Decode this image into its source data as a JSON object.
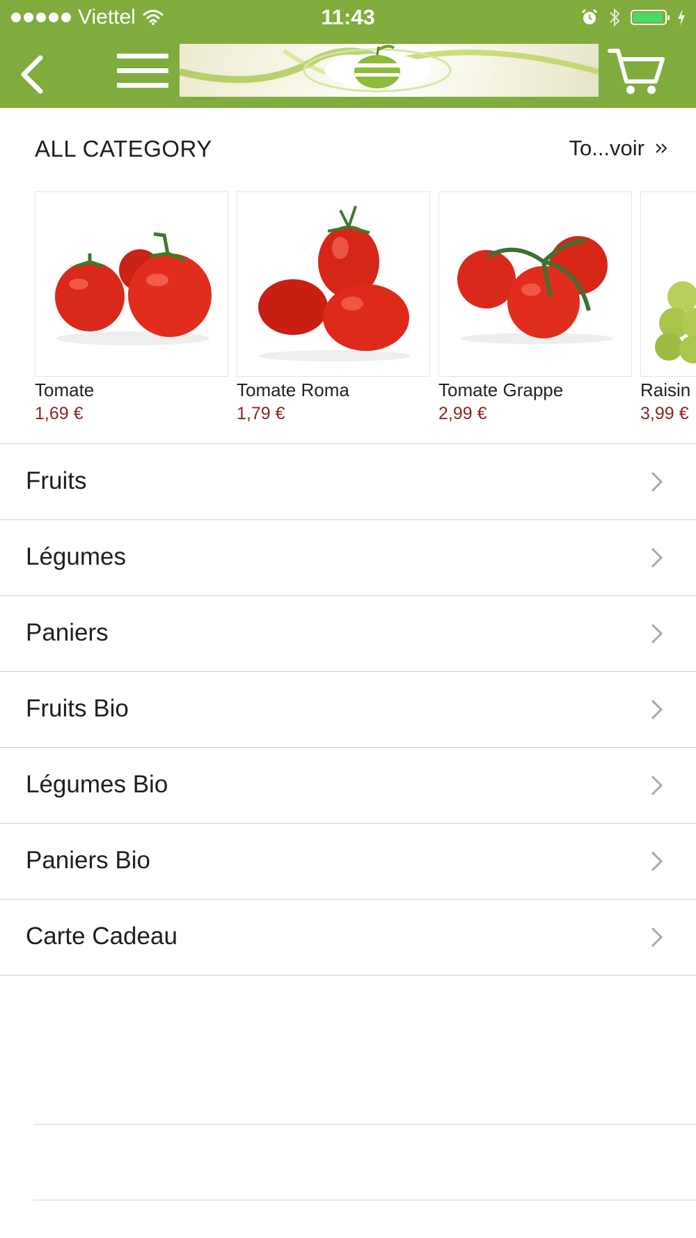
{
  "status_bar": {
    "carrier": "Viettel",
    "time": "11:43",
    "battery_level": 0.95
  },
  "navbar": {
    "back_icon": "chevron-left-icon",
    "menu_icon": "hamburger-menu-icon",
    "logo": "brand-banner-apple-logo",
    "cart_icon": "shopping-cart-icon"
  },
  "section": {
    "title": "ALL CATEGORY",
    "see_all": "To...voir",
    "see_all_icon": "double-chevron-right-icon"
  },
  "products": [
    {
      "name": "Tomate",
      "price": "1,69 €",
      "image": "tomatoes"
    },
    {
      "name": "Tomate Roma",
      "price": "1,79 €",
      "image": "roma-tomatoes"
    },
    {
      "name": "Tomate Grappe",
      "price": "2,99 €",
      "image": "vine-tomatoes"
    },
    {
      "name": "Raisin",
      "price": "3,99 €",
      "image": "grapes"
    }
  ],
  "categories": [
    {
      "label": "Fruits"
    },
    {
      "label": "Légumes"
    },
    {
      "label": "Paniers"
    },
    {
      "label": "Fruits Bio"
    },
    {
      "label": "Légumes Bio"
    },
    {
      "label": "Paniers Bio"
    },
    {
      "label": "Carte Cadeau"
    }
  ],
  "colors": {
    "header_green": "#7fac3d",
    "price_red": "#8b2424",
    "tomato_red": "#d9291b"
  }
}
